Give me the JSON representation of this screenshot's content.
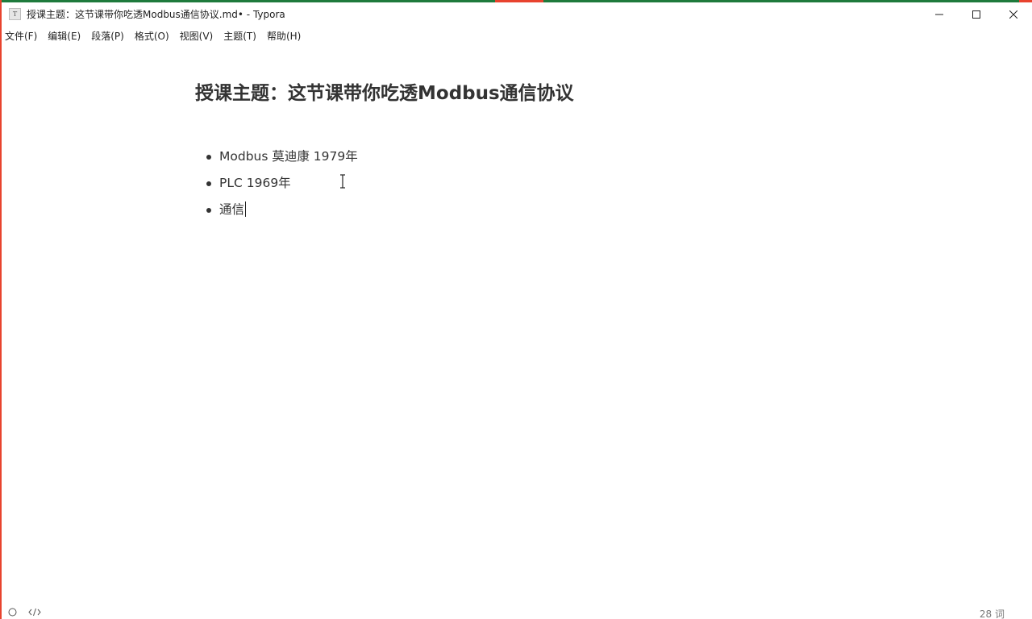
{
  "window": {
    "title": "授课主题：这节课带你吃透Modbus通信协议.md• - Typora",
    "icon_letter": "T",
    "accent_color": "#e8432e",
    "controls": [
      "minimize-icon",
      "maximize-icon",
      "close-icon"
    ]
  },
  "menubar": {
    "items": [
      {
        "label": "文件(F)"
      },
      {
        "label": "编辑(E)"
      },
      {
        "label": "段落(P)"
      },
      {
        "label": "格式(O)"
      },
      {
        "label": "视图(V)"
      },
      {
        "label": "主题(T)"
      },
      {
        "label": "帮助(H)"
      }
    ]
  },
  "document": {
    "title": "授课主题：这节课带你吃透Modbus通信协议",
    "items": [
      {
        "text": "Modbus  莫迪康  1979年"
      },
      {
        "text": "PLC  1969年"
      },
      {
        "text": "通信"
      }
    ]
  },
  "statusbar": {
    "left_icons": [
      "sidebar-toggle-icon",
      "source-code-icon"
    ],
    "word_count": "28 词"
  }
}
